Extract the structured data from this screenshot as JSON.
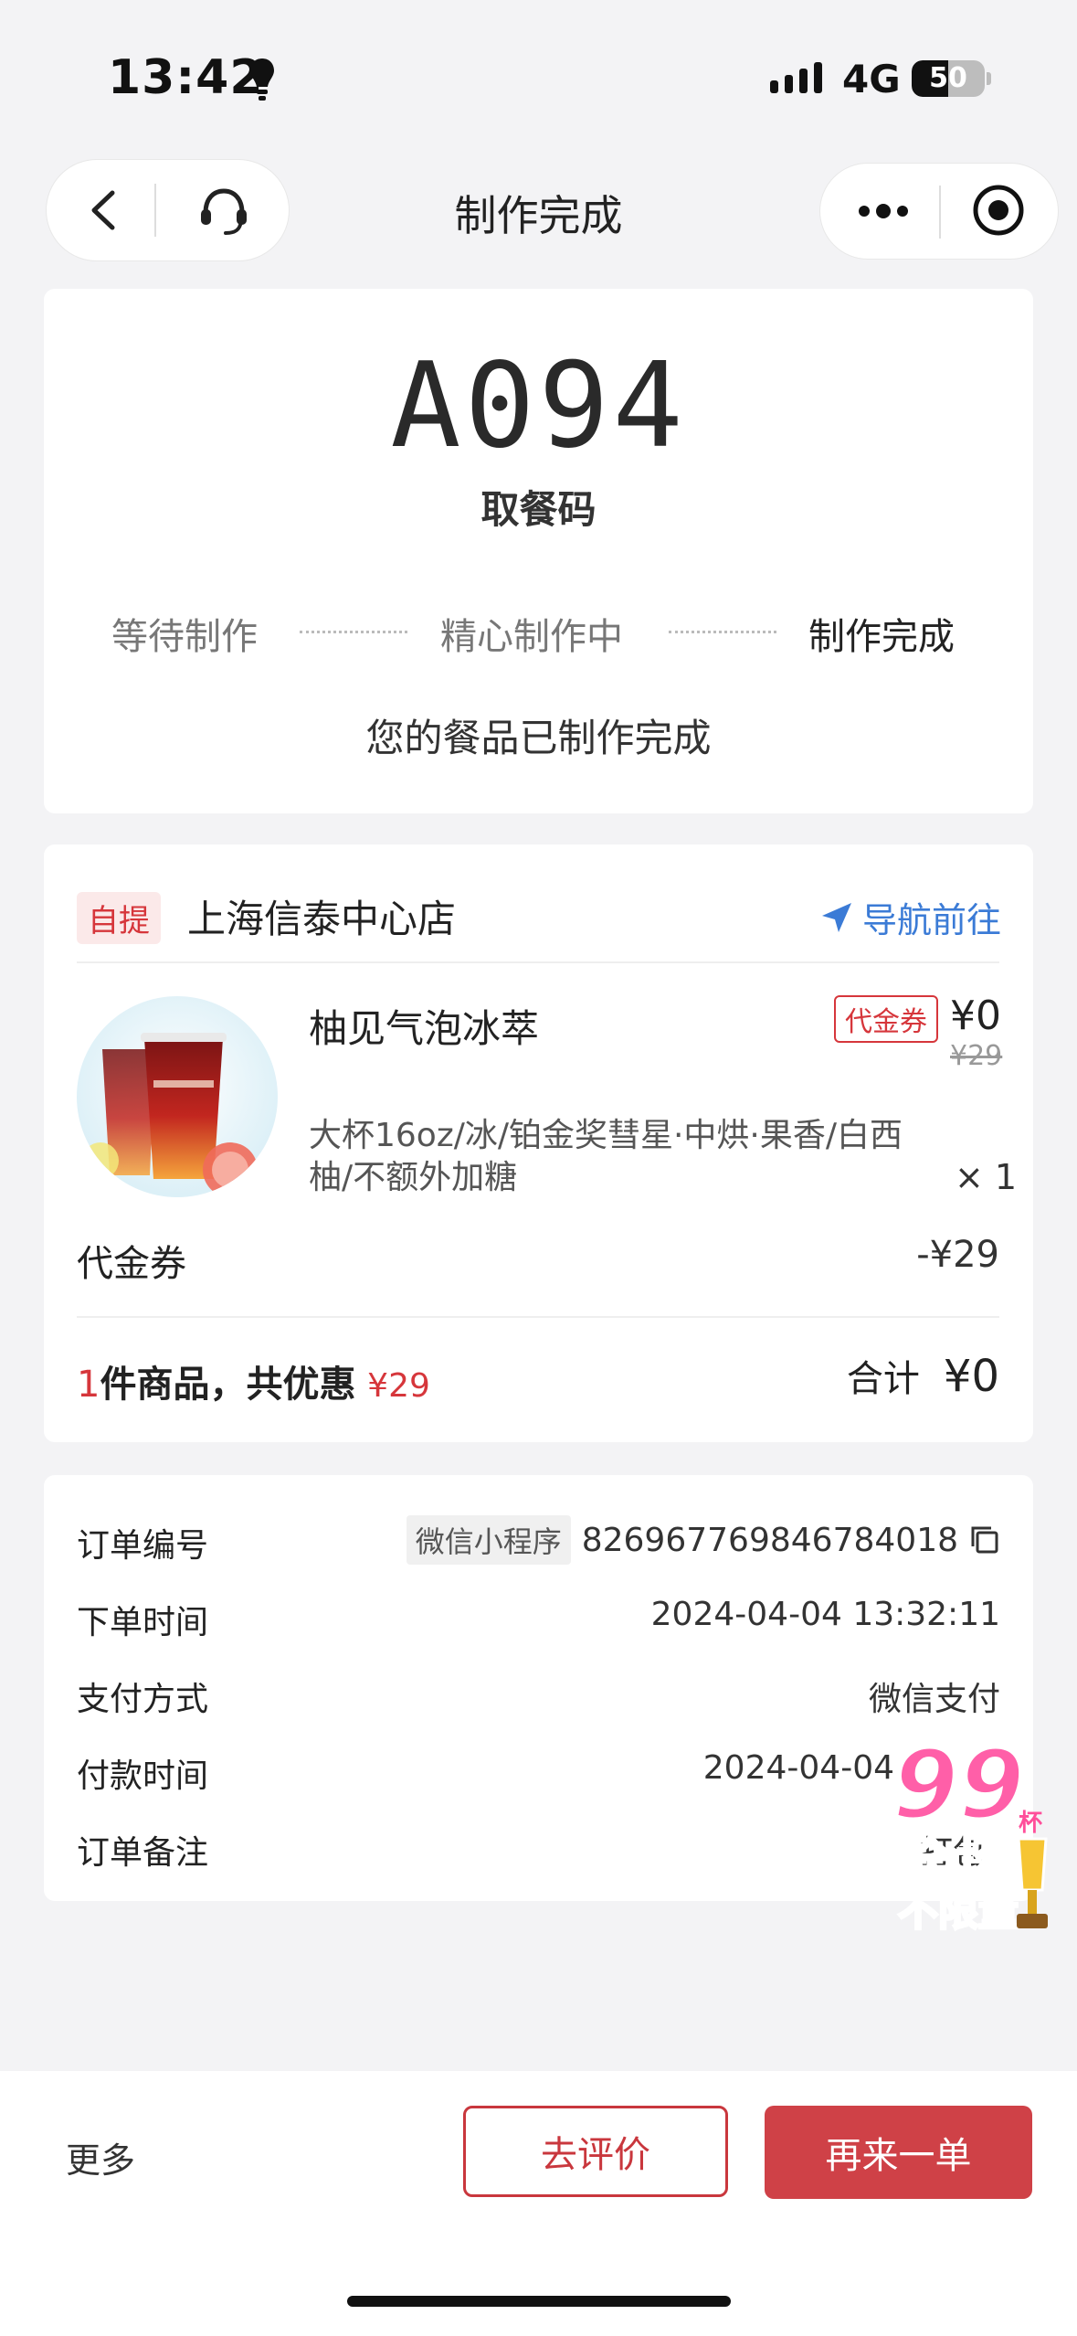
{
  "status_bar": {
    "time": "13:42",
    "network": "4G",
    "battery": "50",
    "battery_level": 0.5
  },
  "nav": {
    "title": "制作完成",
    "back_icon": "chevron-left-icon",
    "service_icon": "headset-icon",
    "more_icon": "more-dots-icon",
    "target_icon": "target-icon"
  },
  "pickup": {
    "code": "A094",
    "code_label": "取餐码",
    "steps": [
      "等待制作",
      "精心制作中",
      "制作完成"
    ],
    "message": "您的餐品已制作完成"
  },
  "order": {
    "tag": "自提",
    "store": "上海信泰中心店",
    "navigate": "导航前往",
    "product": {
      "name": "柚见气泡冰萃",
      "voucher_tag": "代金券",
      "price": "¥0",
      "original_price": "¥29",
      "spec": "大杯16oz/冰/铂金奖彗星·中烘·果香/白西柚/不额外加糖",
      "qty": "× 1"
    },
    "voucher_label": "代金券",
    "voucher_value": "-¥29",
    "summary": {
      "count": "1",
      "text": "件商品，共优惠",
      "discount": "¥29",
      "total_label": "合计",
      "total": "¥0"
    }
  },
  "info": {
    "rows": [
      {
        "label": "订单编号",
        "tag": "微信小程序",
        "value": "826967769846784018"
      },
      {
        "label": "下单时间",
        "value": "2024-04-04 13:32:11"
      },
      {
        "label": "支付方式",
        "value": "微信支付"
      },
      {
        "label": "付款时间",
        "value": "2024-04-04"
      },
      {
        "label": "订单备注",
        "value": "打包"
      }
    ]
  },
  "promo": {
    "big": "99",
    "cup": "杯",
    "line1": "全场",
    "line2": "不限量"
  },
  "bottom": {
    "more": "更多",
    "review": "去评价",
    "reorder": "再来一单"
  },
  "colors": {
    "accent": "#cf4147",
    "link": "#3b7bd6",
    "background": "#f3f3f5"
  }
}
